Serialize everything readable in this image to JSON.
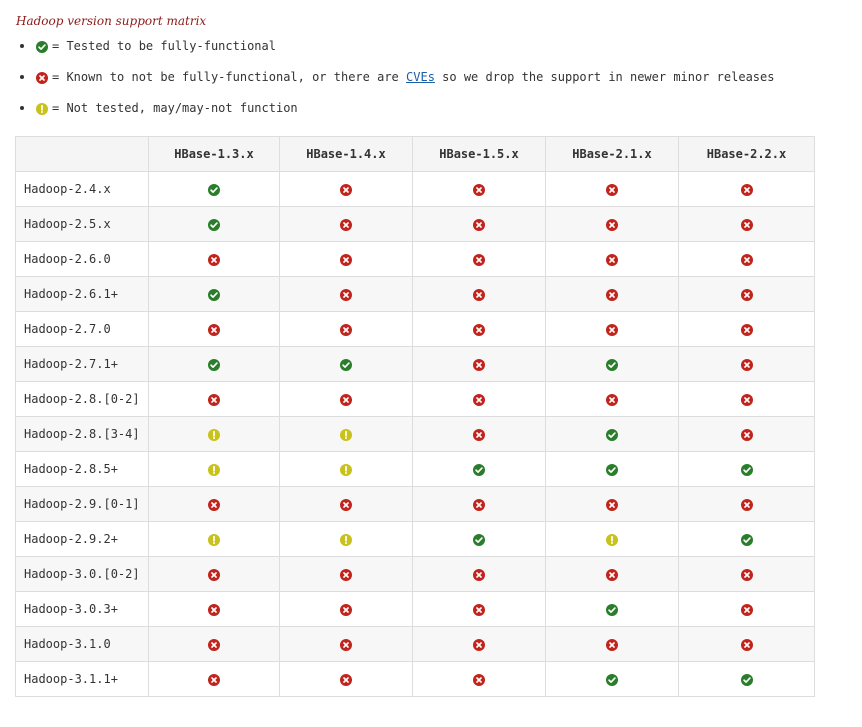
{
  "caption": "Hadoop version support matrix",
  "legend": {
    "items": [
      {
        "status": "ok",
        "text": "= Tested to be fully-functional"
      },
      {
        "status": "no",
        "text_before": "= Known to not be fully-functional, or there are ",
        "link": "CVEs",
        "text_after": " so we drop the support in newer minor releases"
      },
      {
        "status": "warn",
        "text": "= Not tested, may/may-not function"
      }
    ]
  },
  "colors": {
    "ok": "#2a7d2a",
    "no": "#c0241c",
    "warn": "#c8c21a",
    "link": "#1a5fa8"
  },
  "icons": {
    "ok": "check-circle-icon",
    "no": "x-circle-icon",
    "warn": "exclamation-circle-icon"
  },
  "table": {
    "columns": [
      "",
      "HBase-1.3.x",
      "HBase-1.4.x",
      "HBase-1.5.x",
      "HBase-2.1.x",
      "HBase-2.2.x"
    ],
    "rows": [
      {
        "label": "Hadoop-2.4.x",
        "cells": [
          "ok",
          "no",
          "no",
          "no",
          "no"
        ]
      },
      {
        "label": "Hadoop-2.5.x",
        "cells": [
          "ok",
          "no",
          "no",
          "no",
          "no"
        ]
      },
      {
        "label": "Hadoop-2.6.0",
        "cells": [
          "no",
          "no",
          "no",
          "no",
          "no"
        ]
      },
      {
        "label": "Hadoop-2.6.1+",
        "cells": [
          "ok",
          "no",
          "no",
          "no",
          "no"
        ]
      },
      {
        "label": "Hadoop-2.7.0",
        "cells": [
          "no",
          "no",
          "no",
          "no",
          "no"
        ]
      },
      {
        "label": "Hadoop-2.7.1+",
        "cells": [
          "ok",
          "ok",
          "no",
          "ok",
          "no"
        ]
      },
      {
        "label": "Hadoop-2.8.[0-2]",
        "cells": [
          "no",
          "no",
          "no",
          "no",
          "no"
        ]
      },
      {
        "label": "Hadoop-2.8.[3-4]",
        "cells": [
          "warn",
          "warn",
          "no",
          "ok",
          "no"
        ]
      },
      {
        "label": "Hadoop-2.8.5+",
        "cells": [
          "warn",
          "warn",
          "ok",
          "ok",
          "ok"
        ]
      },
      {
        "label": "Hadoop-2.9.[0-1]",
        "cells": [
          "no",
          "no",
          "no",
          "no",
          "no"
        ]
      },
      {
        "label": "Hadoop-2.9.2+",
        "cells": [
          "warn",
          "warn",
          "ok",
          "warn",
          "ok"
        ]
      },
      {
        "label": "Hadoop-3.0.[0-2]",
        "cells": [
          "no",
          "no",
          "no",
          "no",
          "no"
        ]
      },
      {
        "label": "Hadoop-3.0.3+",
        "cells": [
          "no",
          "no",
          "no",
          "ok",
          "no"
        ]
      },
      {
        "label": "Hadoop-3.1.0",
        "cells": [
          "no",
          "no",
          "no",
          "no",
          "no"
        ]
      },
      {
        "label": "Hadoop-3.1.1+",
        "cells": [
          "no",
          "no",
          "no",
          "ok",
          "ok"
        ]
      }
    ]
  }
}
